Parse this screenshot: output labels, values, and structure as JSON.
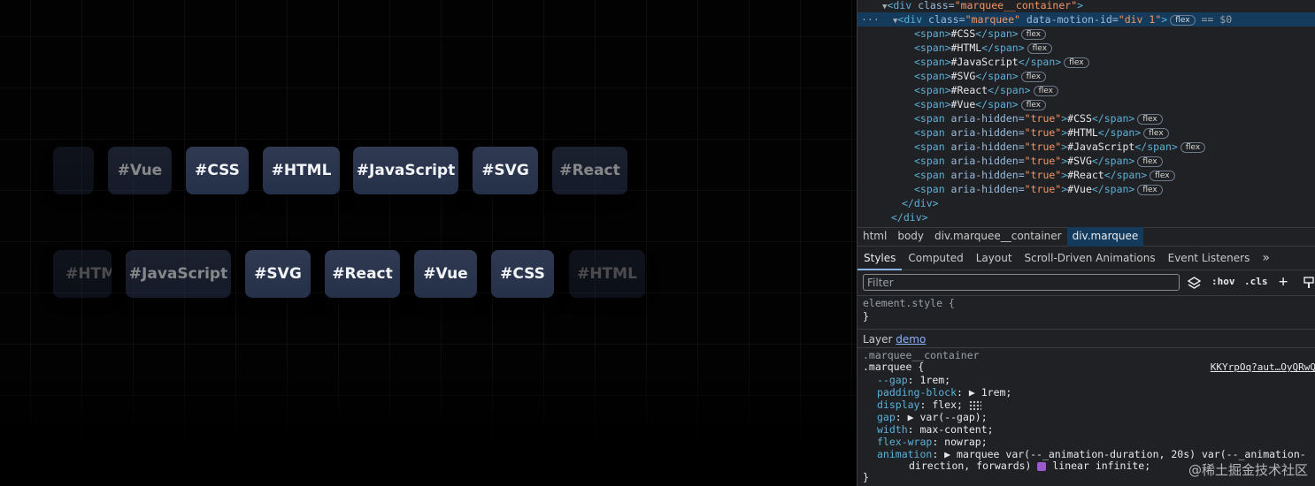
{
  "demo": {
    "row1": [
      "#Vue",
      "#CSS",
      "#HTML",
      "#JavaScript",
      "#SVG",
      "#React"
    ],
    "row2": [
      "#HTML",
      "#JavaScript",
      "#SVG",
      "#React",
      "#Vue",
      "#CSS",
      "#HTML"
    ]
  },
  "dom": {
    "container_tag": "div",
    "container_class_attr": "class",
    "container_class": "marquee__container",
    "marquee_class": "marquee",
    "marquee_motion_attr": "data-motion-id",
    "marquee_motion_id": "div 1",
    "selected_suffix": "== $0",
    "flex_pill": "flex",
    "spans": [
      "#CSS",
      "#HTML",
      "#JavaScript",
      "#SVG",
      "#React",
      "#Vue"
    ],
    "hidden_spans": [
      "#CSS",
      "#HTML",
      "#JavaScript",
      "#SVG",
      "#React",
      "#Vue"
    ],
    "aria_attr": "aria-hidden",
    "aria_val": "true"
  },
  "breadcrumbs": [
    "html",
    "body",
    "div.marquee__container",
    "div.marquee"
  ],
  "tabs": [
    "Styles",
    "Computed",
    "Layout",
    "Scroll-Driven Animations",
    "Event Listeners"
  ],
  "tabs_more": "»",
  "filter": {
    "placeholder": "Filter",
    "hov": ":hov",
    "cls": ".cls",
    "plus": "+"
  },
  "styles": {
    "element_style": "element.style {",
    "close_brace": "}",
    "layer_label": "Layer",
    "layer_name": "demo",
    "parent_selector": ".marquee__container",
    "selector": ".marquee {",
    "source": "KKYrpOq?aut…OyQRwQ",
    "rules": [
      {
        "prop": "--gap",
        "value": "1rem;"
      },
      {
        "prop": "padding-block",
        "value": "▶ 1rem;"
      },
      {
        "prop": "display",
        "value": "flex;"
      },
      {
        "prop": "gap",
        "value": "▶ var(--gap);"
      },
      {
        "prop": "width",
        "value": "max-content;"
      },
      {
        "prop": "flex-wrap",
        "value": "nowrap;"
      },
      {
        "prop": "animation",
        "value": "▶ marquee var(--_animation-duration, 20s) var(--_animation-"
      }
    ],
    "animation_cont": "direction, forwards)",
    "animation_tail": "linear infinite;"
  },
  "watermark": "@稀土掘金技术社区"
}
